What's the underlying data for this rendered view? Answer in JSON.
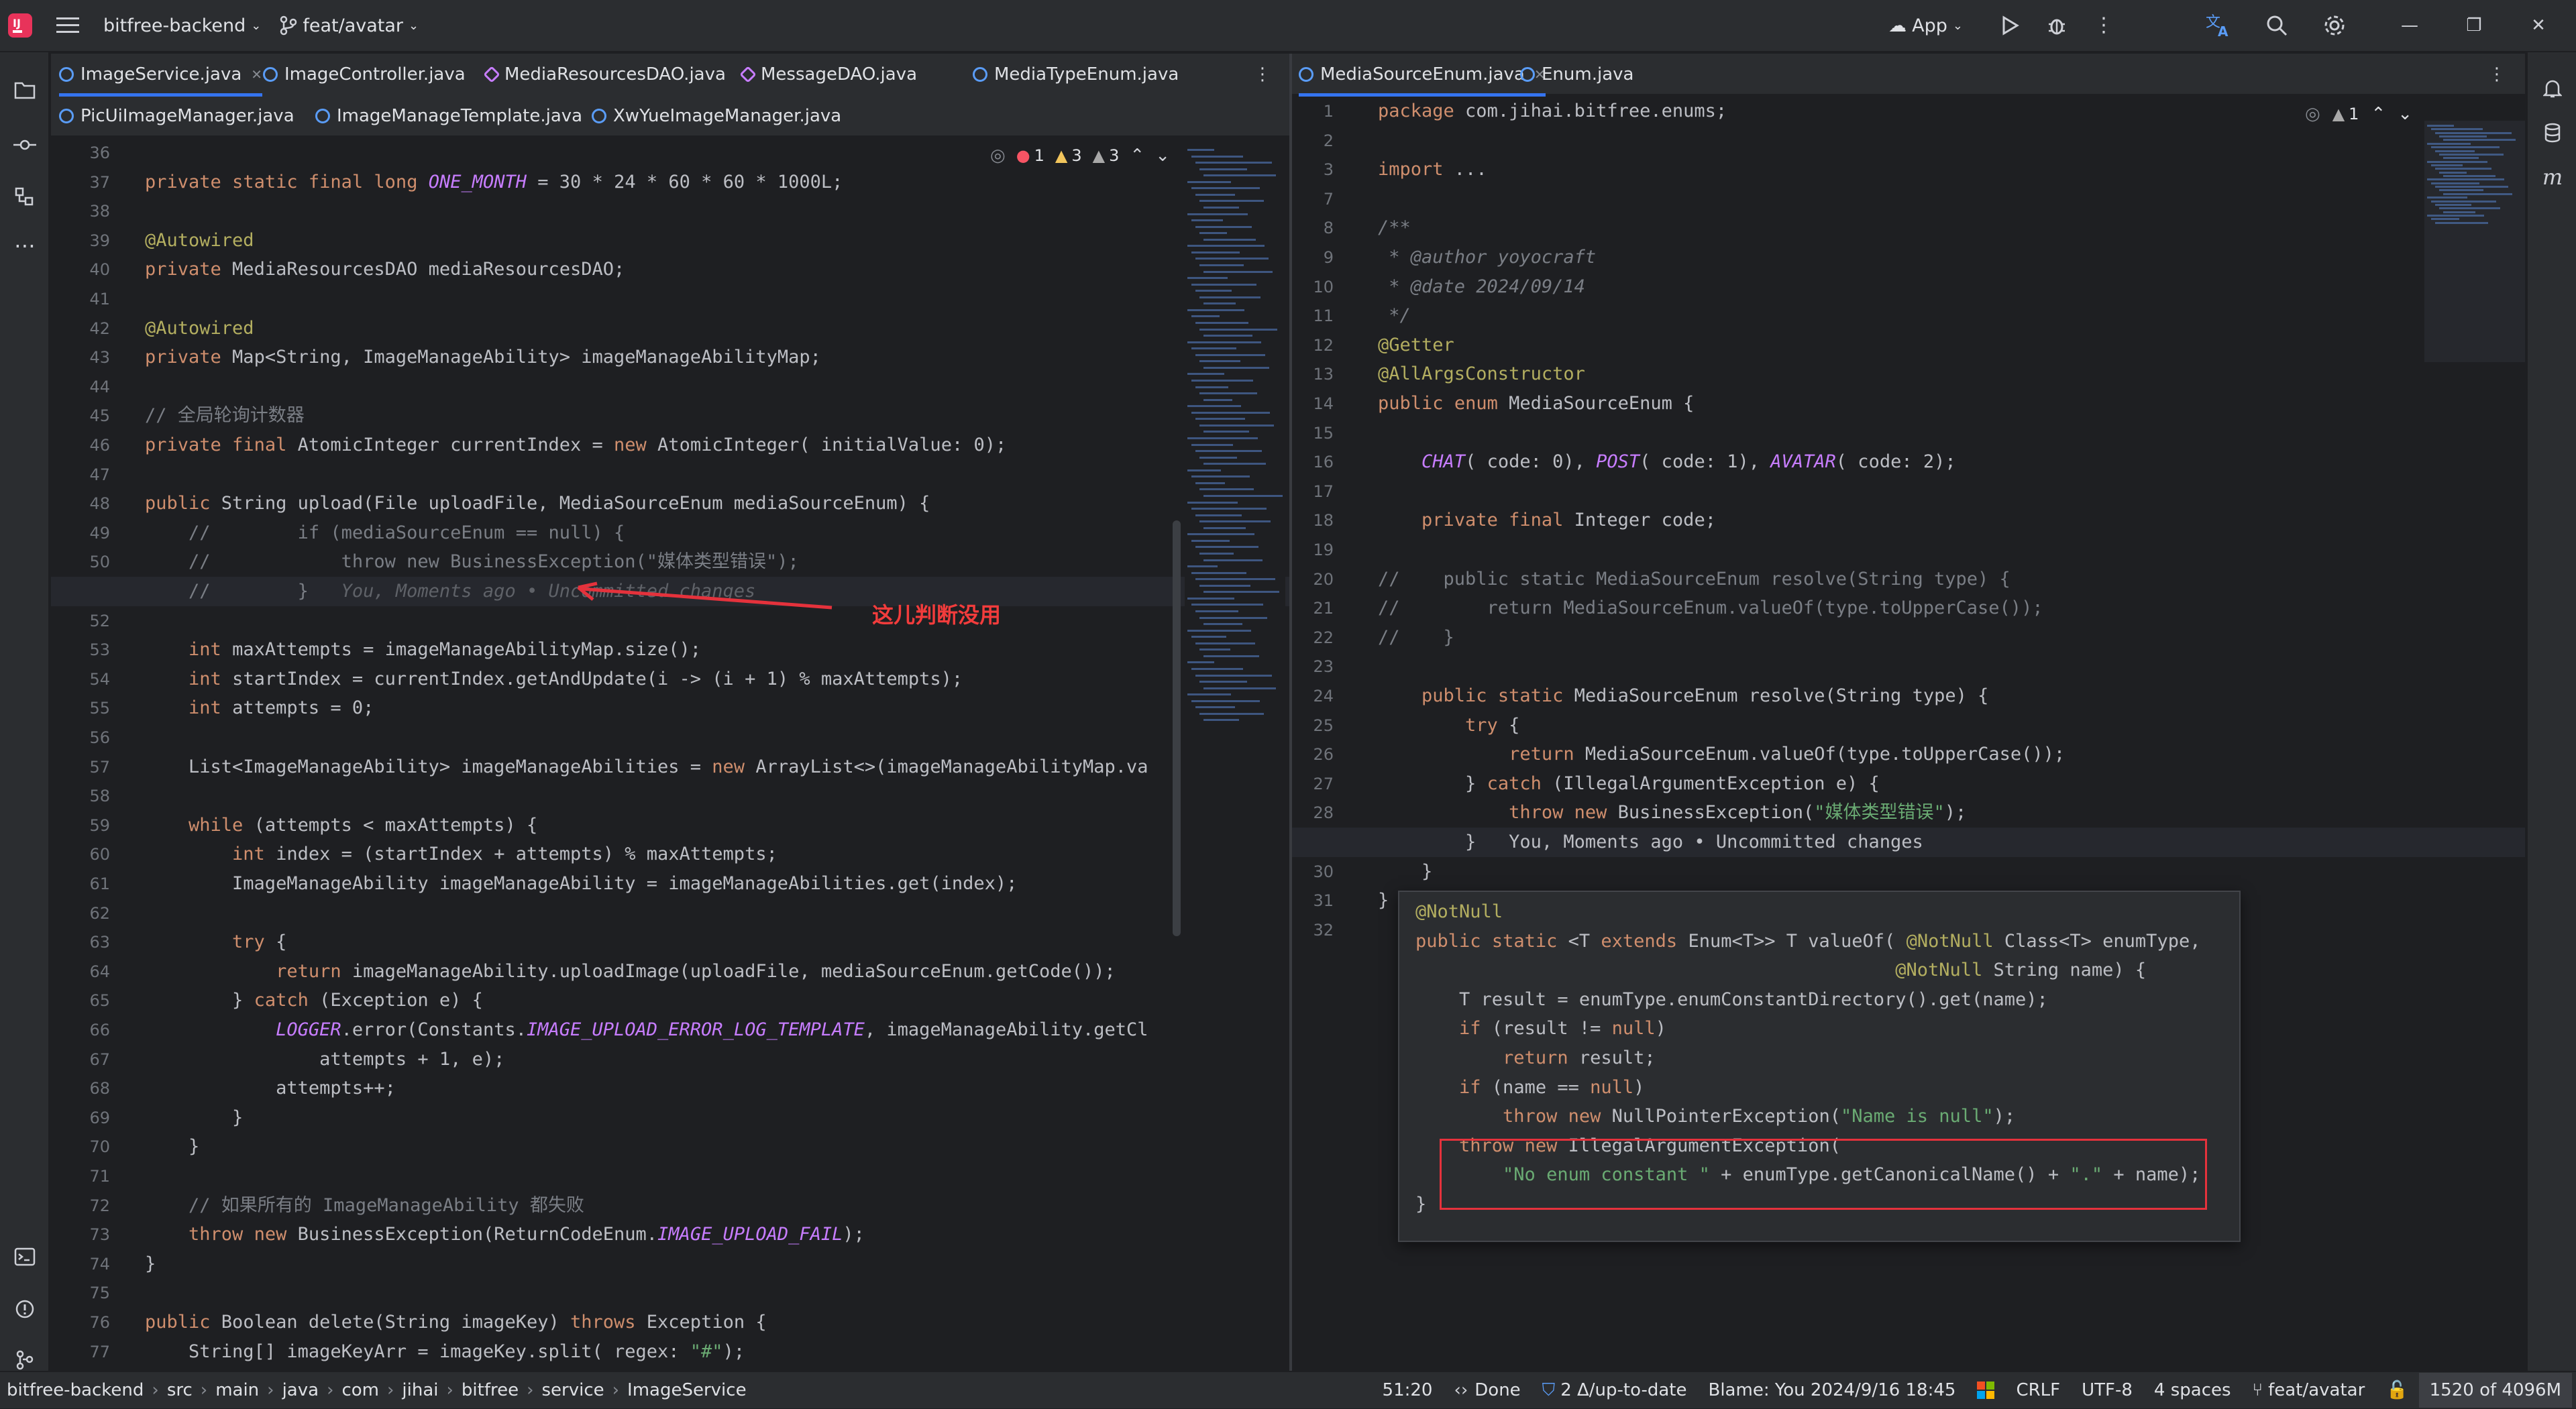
{
  "titlebar": {
    "project": "bitfree-backend",
    "branch": "feat/avatar",
    "run_config": "App"
  },
  "left_tabs_row1": [
    {
      "label": "ImageService.java",
      "active": true,
      "closable": true
    },
    {
      "label": "ImageController.java"
    },
    {
      "label": "MediaResourcesDAO.java"
    },
    {
      "label": "MessageDAO.java"
    },
    {
      "label": "MediaTypeEnum.java"
    }
  ],
  "left_tabs_row2": [
    {
      "label": "PicUiImageManager.java"
    },
    {
      "label": "ImageManageTemplate.java"
    },
    {
      "label": "XwYueImageManager.java"
    }
  ],
  "right_tabs": [
    {
      "label": "MediaSourceEnum.java",
      "active": true,
      "closable": true
    },
    {
      "label": "Enum.java"
    }
  ],
  "left_inspections": {
    "errors": "1",
    "warnings": "3",
    "weak": "3"
  },
  "right_inspections": {
    "warnings": "1"
  },
  "left_lines": [
    {
      "n": "36",
      "t": ""
    },
    {
      "n": "37",
      "t": "private static final long ONE_MONTH = 30 * 24 * 60 * 60 * 1000L;"
    },
    {
      "n": "38",
      "t": ""
    },
    {
      "n": "39",
      "t": "@Autowired"
    },
    {
      "n": "40",
      "t": "private MediaResourcesDAO mediaResourcesDAO;"
    },
    {
      "n": "41",
      "t": ""
    },
    {
      "n": "42",
      "t": "@Autowired"
    },
    {
      "n": "43",
      "t": "private Map<String, ImageManageAbility> imageManageAbilityMap;"
    },
    {
      "n": "44",
      "t": ""
    },
    {
      "n": "45",
      "t": "// 全局轮询计数器"
    },
    {
      "n": "46",
      "t": "private final AtomicInteger currentIndex = new AtomicInteger( initialValue: 0);"
    },
    {
      "n": "47",
      "t": ""
    },
    {
      "n": "48",
      "t": "public String upload(File uploadFile, MediaSourceEnum mediaSourceEnum) {"
    },
    {
      "n": "49",
      "t": "    //        if (mediaSourceEnum == null) {"
    },
    {
      "n": "50",
      "t": "    //            throw new BusinessException(\"媒体类型错误\");"
    },
    {
      "n": "51",
      "t": "    //        }   You, Moments ago • Uncommitted changes"
    },
    {
      "n": "52",
      "t": ""
    },
    {
      "n": "53",
      "t": "    int maxAttempts = imageManageAbilityMap.size();"
    },
    {
      "n": "54",
      "t": "    int startIndex = currentIndex.getAndUpdate(i -> (i + 1) % maxAttempts);"
    },
    {
      "n": "55",
      "t": "    int attempts = 0;"
    },
    {
      "n": "56",
      "t": ""
    },
    {
      "n": "57",
      "t": "    List<ImageManageAbility> imageManageAbilities = new ArrayList<>(imageManageAbilityMap.va"
    },
    {
      "n": "58",
      "t": ""
    },
    {
      "n": "59",
      "t": "    while (attempts < maxAttempts) {"
    },
    {
      "n": "60",
      "t": "        int index = (startIndex + attempts) % maxAttempts;"
    },
    {
      "n": "61",
      "t": "        ImageManageAbility imageManageAbility = imageManageAbilities.get(index);"
    },
    {
      "n": "62",
      "t": ""
    },
    {
      "n": "63",
      "t": "        try {"
    },
    {
      "n": "64",
      "t": "            return imageManageAbility.uploadImage(uploadFile, mediaSourceEnum.getCode());"
    },
    {
      "n": "65",
      "t": "        } catch (Exception e) {"
    },
    {
      "n": "66",
      "t": "            LOGGER.error(Constants.IMAGE_UPLOAD_ERROR_LOG_TEMPLATE, imageManageAbility.getCl"
    },
    {
      "n": "67",
      "t": "                attempts + 1, e);"
    },
    {
      "n": "68",
      "t": "            attempts++;"
    },
    {
      "n": "69",
      "t": "        }"
    },
    {
      "n": "70",
      "t": "    }"
    },
    {
      "n": "71",
      "t": ""
    },
    {
      "n": "72",
      "t": "    // 如果所有的 ImageManageAbility 都失败"
    },
    {
      "n": "73",
      "t": "    throw new BusinessException(ReturnCodeEnum.IMAGE_UPLOAD_FAIL);"
    },
    {
      "n": "74",
      "t": "}"
    },
    {
      "n": "75",
      "t": ""
    },
    {
      "n": "76",
      "t": "public Boolean delete(String imageKey) throws Exception {"
    },
    {
      "n": "77",
      "t": "    String[] imageKeyArr = imageKey.split( regex: \"#\");"
    }
  ],
  "right_lines": [
    {
      "n": "1",
      "t": "package com.jihai.bitfree.enums;"
    },
    {
      "n": "2",
      "t": ""
    },
    {
      "n": "3",
      "t": "import ..."
    },
    {
      "n": "7",
      "t": ""
    },
    {
      "n": "8",
      "t": "/**"
    },
    {
      "n": "9",
      "t": " * @author yoyocraft"
    },
    {
      "n": "10",
      "t": " * @date 2024/09/14"
    },
    {
      "n": "11",
      "t": " */"
    },
    {
      "n": "12",
      "t": "@Getter"
    },
    {
      "n": "13",
      "t": "@AllArgsConstructor"
    },
    {
      "n": "14",
      "t": "public enum MediaSourceEnum {"
    },
    {
      "n": "15",
      "t": ""
    },
    {
      "n": "16",
      "t": "    CHAT( code: 0), POST( code: 1), AVATAR( code: 2);"
    },
    {
      "n": "17",
      "t": ""
    },
    {
      "n": "18",
      "t": "    private final Integer code;"
    },
    {
      "n": "19",
      "t": ""
    },
    {
      "n": "20",
      "t": "//    public static MediaSourceEnum resolve(String type) {"
    },
    {
      "n": "21",
      "t": "//        return MediaSourceEnum.valueOf(type.toUpperCase());"
    },
    {
      "n": "22",
      "t": "//    }"
    },
    {
      "n": "23",
      "t": ""
    },
    {
      "n": "24",
      "t": "    public static MediaSourceEnum resolve(String type) {"
    },
    {
      "n": "25",
      "t": "        try {"
    },
    {
      "n": "26",
      "t": "            return MediaSourceEnum.valueOf(type.toUpperCase());"
    },
    {
      "n": "27",
      "t": "        } catch (IllegalArgumentException e) {"
    },
    {
      "n": "28",
      "t": "            throw new BusinessException(\"媒体类型错误\");"
    },
    {
      "n": "29",
      "t": "        }   You, Moments ago • Uncommitted changes"
    },
    {
      "n": "30",
      "t": "    }"
    },
    {
      "n": "31",
      "t": "}"
    },
    {
      "n": "32",
      "t": ""
    }
  ],
  "popup_lines": [
    "@NotNull",
    "public static <T extends Enum<T>> T valueOf( @NotNull Class<T> enumType,",
    "                                            @NotNull String name) {",
    "    T result = enumType.enumConstantDirectory().get(name);",
    "    if (result != null)",
    "        return result;",
    "    if (name == null)",
    "        throw new NullPointerException(\"Name is null\");",
    "    throw new IllegalArgumentException(",
    "        \"No enum constant \" + enumType.getCanonicalName() + \".\" + name);",
    "}"
  ],
  "annotation": "这儿判断没用",
  "statusbar": {
    "breadcrumbs": [
      "bitfree-backend",
      "src",
      "main",
      "java",
      "com",
      "jihai",
      "bitfree",
      "service",
      "ImageService"
    ],
    "position": "51:20",
    "done": "Done",
    "vcs": "2 Δ/up-to-date",
    "blame": "Blame: You 2024/9/16 18:45",
    "line_sep": "CRLF",
    "encoding": "UTF-8",
    "indent": "4 spaces",
    "branch": "feat/avatar",
    "memory": "1520 of 4096M"
  },
  "colors": {
    "keyword": "#cf8e6d",
    "string": "#6aab73",
    "comment": "#7a7e85",
    "annotation": "#b3ae60",
    "type": "#bcbec4",
    "field": "#c77dff",
    "method": "#56a8f5",
    "accent": "#3574f0",
    "error": "#f75464"
  }
}
